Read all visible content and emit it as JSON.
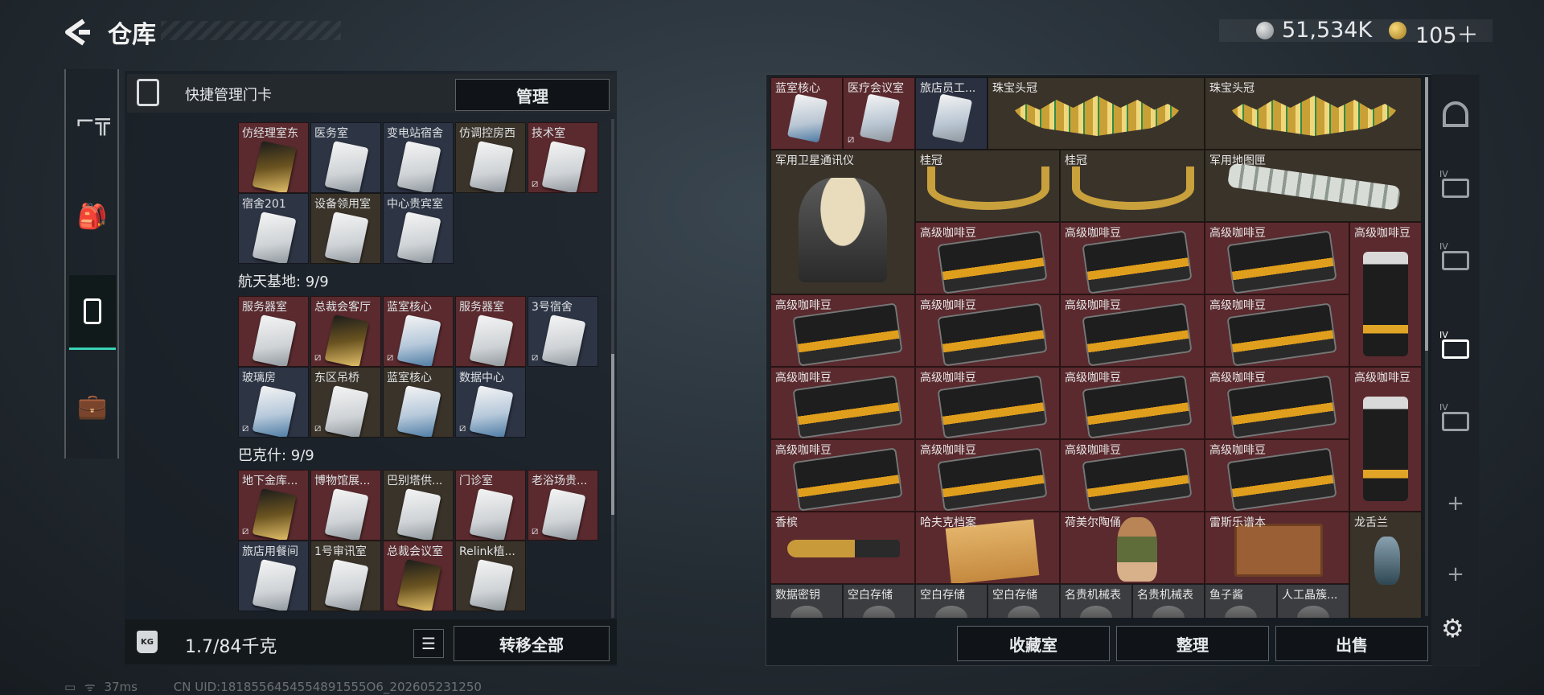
{
  "header": {
    "title": "仓库",
    "money": "51,534K",
    "tokens": "105＋"
  },
  "left_nav": [
    {
      "icon": "pistol-icon"
    },
    {
      "icon": "backpack-icon"
    },
    {
      "icon": "keycard-icon",
      "active": true
    },
    {
      "icon": "briefcase-icon"
    }
  ],
  "quick": {
    "title": "快捷管理门卡",
    "manage_label": "管理"
  },
  "sections": [
    {
      "title": "",
      "items": [
        {
          "name": "仿经理室东",
          "style": "gold",
          "bg": "#5a2a2e",
          "no_badge": false
        },
        {
          "name": "医务室",
          "style": "silver",
          "bg": "#2d3444"
        },
        {
          "name": "变电站宿舍",
          "style": "silver",
          "bg": "#2d3444"
        },
        {
          "name": "仿调控房西",
          "style": "silver",
          "bg": "#3a332a"
        },
        {
          "name": "技术室",
          "style": "silver",
          "bg": "#5a2a2e",
          "no_badge": true
        },
        {
          "name": "宿舍201",
          "style": "silver",
          "bg": "#2d3444"
        },
        {
          "name": "设备领用室",
          "style": "silver",
          "bg": "#3a332a"
        },
        {
          "name": "中心贵宾室",
          "style": "silver",
          "bg": "#2d3444"
        }
      ]
    },
    {
      "title": "航天基地: 9/9",
      "items": [
        {
          "name": "服务器室",
          "style": "silver",
          "bg": "#5a2a2e"
        },
        {
          "name": "总裁会客厅",
          "style": "gold",
          "bg": "#5a2a2e",
          "no_badge": true
        },
        {
          "name": "蓝室核心",
          "style": "blue",
          "bg": "#5a2a2e",
          "no_badge": true
        },
        {
          "name": "服务器室",
          "style": "silver",
          "bg": "#5a2a2e"
        },
        {
          "name": "3号宿舍",
          "style": "silver",
          "bg": "#2d3444",
          "no_badge": true
        },
        {
          "name": "玻璃房",
          "style": "blue",
          "bg": "#2d3444",
          "no_badge": true
        },
        {
          "name": "东区吊桥",
          "style": "silver",
          "bg": "#3a332a",
          "no_badge": true
        },
        {
          "name": "蓝室核心",
          "style": "blue",
          "bg": "#3a332a"
        },
        {
          "name": "数据中心",
          "style": "blue",
          "bg": "#2d3444",
          "no_badge": true
        }
      ]
    },
    {
      "title": "巴克什: 9/9",
      "items": [
        {
          "name": "地下金库...",
          "style": "gold",
          "bg": "#5a2a2e",
          "no_badge": true
        },
        {
          "name": "博物馆展...",
          "style": "silver",
          "bg": "#5a2a2e"
        },
        {
          "name": "巴别塔供...",
          "style": "silver",
          "bg": "#3a332a"
        },
        {
          "name": "门诊室",
          "style": "silver",
          "bg": "#5a2a2e"
        },
        {
          "name": "老浴场贵...",
          "style": "silver",
          "bg": "#5a2a2e",
          "no_badge": true
        },
        {
          "name": "旅店用餐间",
          "style": "silver",
          "bg": "#2d3444"
        },
        {
          "name": "1号审讯室",
          "style": "silver",
          "bg": "#3a332a"
        },
        {
          "name": "总裁会议室",
          "style": "gold",
          "bg": "#5a2a2e"
        },
        {
          "name": "Relink植...",
          "style": "silver",
          "bg": "#3a332a"
        }
      ]
    }
  ],
  "footer_left": {
    "weight_label": "KG",
    "weight": "1.7/84千克",
    "transfer_label": "转移全部"
  },
  "inventory": {
    "row1": [
      {
        "name": "蓝室核心",
        "kind": "card-blue",
        "w": 1,
        "bg": "#5b2a2e"
      },
      {
        "name": "医疗会议室",
        "kind": "card",
        "w": 1,
        "bg": "#5b2a2e",
        "no_badge": true
      },
      {
        "name": "旅店员工...",
        "kind": "card",
        "w": 1,
        "bg": "#2b3040"
      },
      {
        "name": "珠宝头冠",
        "kind": "crown",
        "w": 3,
        "bg": "#3a332a"
      },
      {
        "name": "珠宝头冠",
        "kind": "crown",
        "w": 3,
        "bg": "#3a332a"
      }
    ],
    "row2": [
      {
        "name": "军用卫星通讯仪",
        "kind": "sat",
        "w": 2,
        "h": 2,
        "bg": "#3a332a"
      },
      {
        "name": "桂冠",
        "kind": "laurel",
        "w": 2,
        "bg": "#3a332a"
      },
      {
        "name": "桂冠",
        "kind": "laurel",
        "w": 2,
        "bg": "#3a332a"
      },
      {
        "name": "军用地图匣",
        "kind": "tube",
        "w": 3,
        "bg": "#3a332a"
      }
    ],
    "coffee_label": "高级咖啡豆",
    "row7": [
      {
        "name": "香槟",
        "kind": "bottle",
        "w": 2,
        "bg": "#5b2a2e"
      },
      {
        "name": "哈夫克档案",
        "kind": "file",
        "w": 2,
        "bg": "#5b2a2e"
      },
      {
        "name": "荷美尔陶俑",
        "kind": "figure",
        "w": 2,
        "bg": "#5b2a2e"
      },
      {
        "name": "雷斯乐谱本",
        "kind": "book",
        "w": 2,
        "bg": "#5b2a2e"
      },
      {
        "name": "龙舌兰",
        "kind": "vase",
        "w": 1,
        "bg": "#3a332a"
      }
    ],
    "row8": [
      "数据密钥",
      "空白存储",
      "空白存储",
      "空白存储",
      "名贵机械表",
      "名贵机械表",
      "鱼子酱",
      "人工晶簇..."
    ]
  },
  "footer_right": {
    "collection": "收藏室",
    "sort": "整理",
    "sell": "出售"
  },
  "right_nav": [
    {
      "icon": "vault-icon",
      "label": ""
    },
    {
      "icon": "case-level-4-icon",
      "label": "IV"
    },
    {
      "icon": "case-level-4-icon",
      "label": "IV"
    },
    {
      "icon": "case-level-4-icon",
      "label": "IV",
      "active": true
    },
    {
      "icon": "case-level-4-icon",
      "label": "IV"
    },
    {
      "icon": "plus-icon",
      "label": "+"
    },
    {
      "icon": "plus-icon",
      "label": "+"
    }
  ],
  "status": {
    "ping": "37ms",
    "uid": "CN UID:1818556454554891555O6_202605231250"
  },
  "colors": {
    "accent": "#39d2b6",
    "red_slot": "#5b2a2e",
    "brown_slot": "#3a332a",
    "blue_slot": "#2b3040"
  }
}
